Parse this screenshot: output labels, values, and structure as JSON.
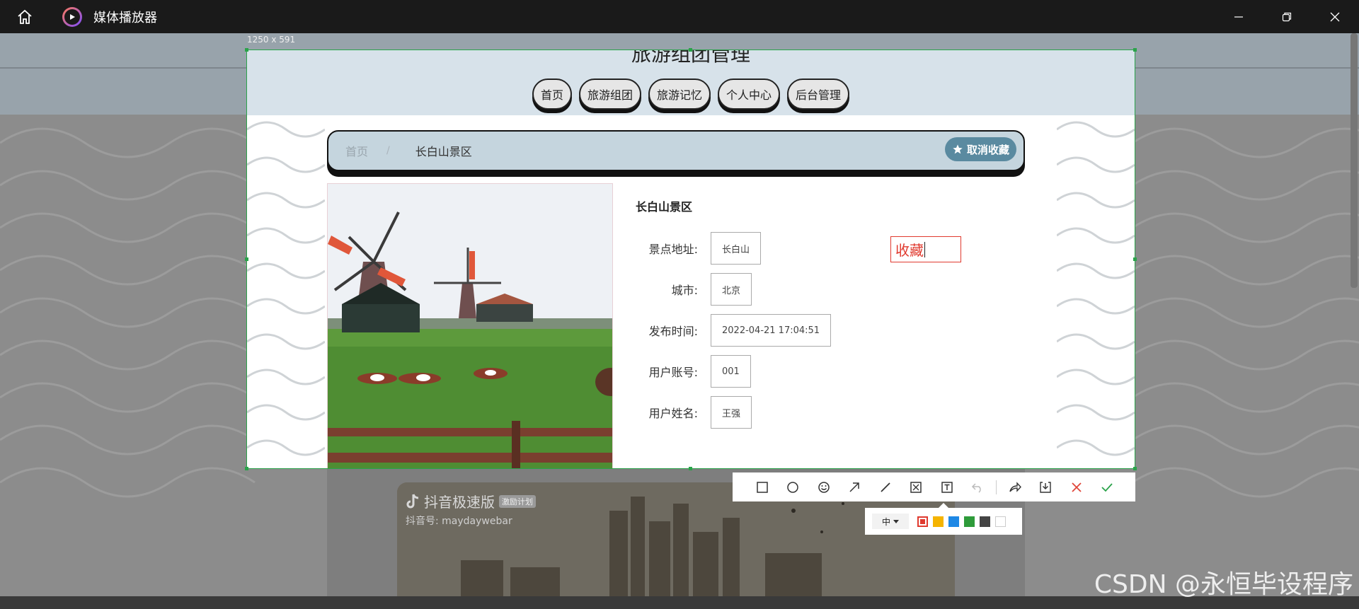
{
  "window": {
    "title": "媒体播放器"
  },
  "capture": {
    "size_label": "1250 x 591"
  },
  "site": {
    "title": "旅游组团管理",
    "nav": [
      {
        "label": "首页"
      },
      {
        "label": "旅游组团"
      },
      {
        "label": "旅游记忆"
      },
      {
        "label": "个人中心"
      },
      {
        "label": "后台管理"
      }
    ]
  },
  "breadcrumb": {
    "home": "首页",
    "separator": "/",
    "current": "长白山景区"
  },
  "favorite_button": {
    "label": "取消收藏",
    "icon": "star-icon",
    "color": "#5a8aa0"
  },
  "detail": {
    "title": "长白山景区",
    "fields": [
      {
        "label": "景点地址:",
        "value": "长白山"
      },
      {
        "label": "城市:",
        "value": "北京"
      },
      {
        "label": "发布时间:",
        "value": "2022-04-21 17:04:51"
      },
      {
        "label": "用户账号:",
        "value": "001"
      },
      {
        "label": "用户姓名:",
        "value": "王强"
      }
    ]
  },
  "annotation": {
    "text": "收藏",
    "color": "#e03a2f"
  },
  "screenshot_toolbar": {
    "tools": [
      "rectangle-icon",
      "ellipse-icon",
      "emoji-icon",
      "arrow-icon",
      "line-icon",
      "mosaic-icon",
      "text-icon",
      "undo-icon",
      "share-icon",
      "download-icon",
      "close-icon",
      "confirm-icon"
    ],
    "size_option": "中",
    "colors": [
      "#e03a2f",
      "#f5b400",
      "#1e88e5",
      "#2e9b3a",
      "#444444",
      "#ffffff"
    ]
  },
  "background_video": {
    "brand": "抖音极速版",
    "tag": "激励计划",
    "account": "抖音号: maydaywebar"
  },
  "watermark": "CSDN @永恒毕设程序"
}
